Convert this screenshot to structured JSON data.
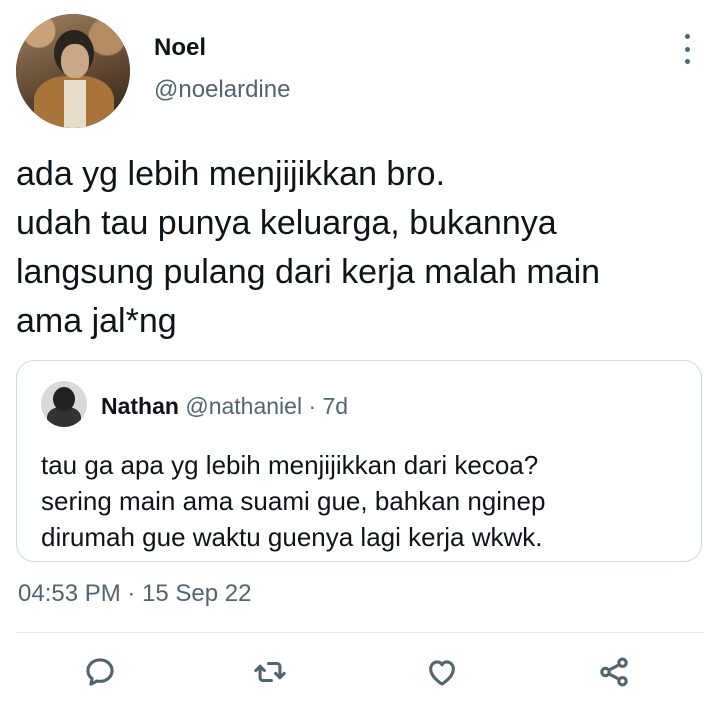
{
  "tweet": {
    "author_name": "Noel",
    "author_handle": "@noelardine",
    "text_lines": [
      "ada yg lebih menjijikkan bro.",
      "udah tau punya keluarga, bukannya",
      "langsung pulang dari kerja malah main",
      "ama jal*ng"
    ],
    "timestamp": "04:53 PM · 15 Sep 22"
  },
  "quote": {
    "author_name": "Nathan",
    "author_handle": "@nathaniel",
    "separator": "·",
    "age": "7d",
    "text_lines": [
      "tau ga apa yg lebih menjijikkan dari kecoa?",
      "sering main ama suami gue, bahkan nginep",
      "dirumah gue waktu guenya lagi kerja wkwk."
    ]
  },
  "actions": {
    "reply_icon": "reply-icon",
    "retweet_icon": "retweet-icon",
    "like_icon": "heart-icon",
    "share_icon": "share-icon"
  },
  "colors": {
    "text": "#0f1419",
    "secondary": "#536471",
    "border": "#cfd9de"
  }
}
